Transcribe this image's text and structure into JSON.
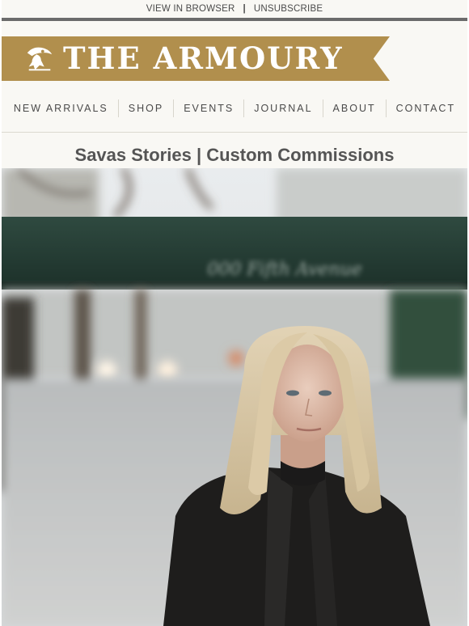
{
  "topbar": {
    "view_in_browser": "VIEW IN BROWSER",
    "separator": "|",
    "unsubscribe": "UNSUBSCRIBE"
  },
  "brand": {
    "name": "THE ARMOURY",
    "logo_icon": "eagle-crest-icon",
    "color": "#b18f4d"
  },
  "nav": {
    "items": [
      "NEW ARRIVALS",
      "SHOP",
      "EVENTS",
      "JOURNAL",
      "ABOUT",
      "CONTACT"
    ]
  },
  "article": {
    "title": "Savas Stories | Custom Commissions"
  },
  "hero": {
    "image_subject": "portrait-photo",
    "awning_text": "000 Fifth Avenue"
  }
}
